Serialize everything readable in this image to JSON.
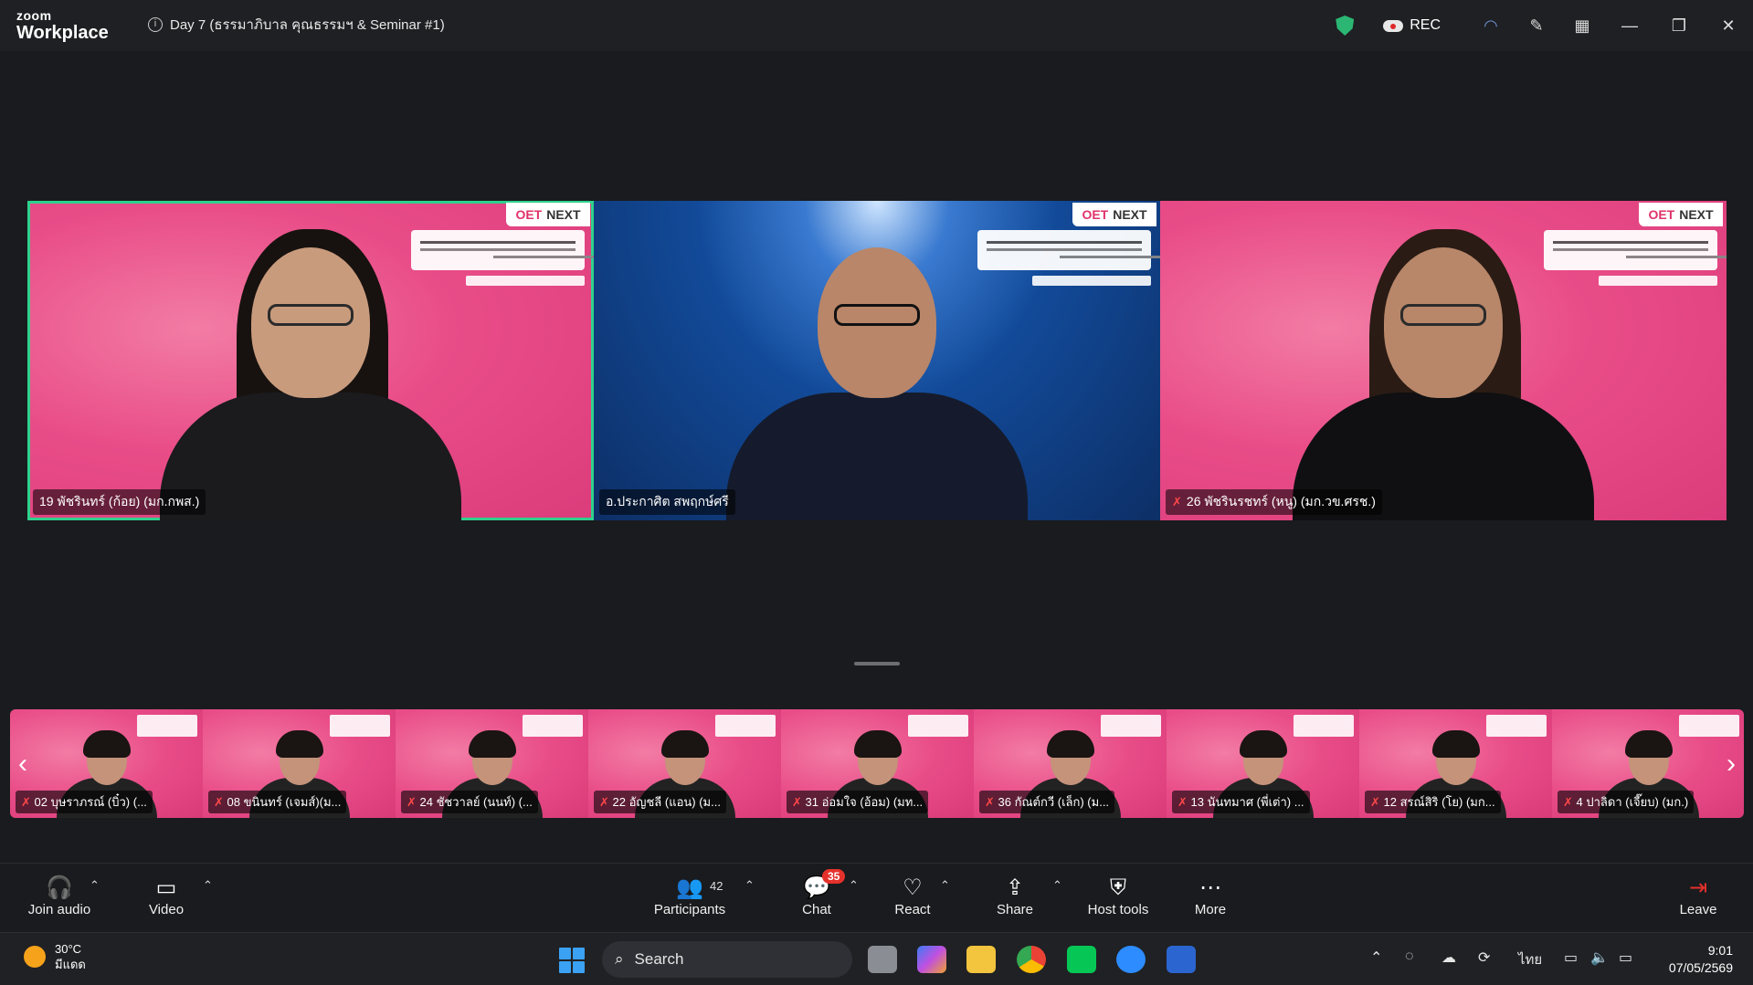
{
  "app": {
    "logo_small": "zoom",
    "logo_big": "Workplace"
  },
  "meeting": {
    "title": "Day 7 (ธรรมาภิบาล คุณธรรมฯ & Seminar #1)"
  },
  "titlebar": {
    "rec_label": "REC"
  },
  "slide_brand": {
    "left": "OET",
    "right": "NEXT"
  },
  "main_tiles": [
    {
      "name": "19 พัชรินทร์ (ก้อย) (มก.กพส.)",
      "muted": false,
      "active": true,
      "bg": "pink"
    },
    {
      "name": "อ.ประกาศิต สพฤกษ์ศรี",
      "muted": false,
      "active": false,
      "bg": "blue"
    },
    {
      "name": "26 พัชรินรชทร์ (หนู) (มก.วข.ศรช.)",
      "muted": true,
      "active": false,
      "bg": "pink"
    }
  ],
  "thumbnails": [
    {
      "name": "02 บุษราภรณ์ (บิ๋ว) (..."
    },
    {
      "name": "08 ขนินทร์ (เจมส์)(ม..."
    },
    {
      "name": "24 ชัชวาลย์ (นนท์) (..."
    },
    {
      "name": "22 อัญชลี (แอน) (ม..."
    },
    {
      "name": "31 อ่อมใจ (อ้อม) (มท..."
    },
    {
      "name": "36 กัณต์กวี (เล็ก) (ม..."
    },
    {
      "name": "13 นันทมาศ (พี่เต่า) ..."
    },
    {
      "name": "12 สรณ์สิริ (โย) (มก..."
    },
    {
      "name": "4 ปาลิดา (เจี๊ยบ) (มก.)"
    }
  ],
  "toolbar": {
    "join_audio": "Join audio",
    "video": "Video",
    "participants": "Participants",
    "participants_count": "42",
    "chat": "Chat",
    "chat_badge": "35",
    "react": "React",
    "share": "Share",
    "host_tools": "Host tools",
    "more": "More",
    "leave": "Leave"
  },
  "taskbar": {
    "weather_temp": "30°C",
    "weather_desc": "มีแดด",
    "search_label": "Search",
    "language": "ไทย",
    "time": "9:01",
    "date": "07/05/2569"
  },
  "colors": {
    "accent_green": "#2fd18c",
    "rec_red": "#e02828",
    "badge_red": "#e5312b"
  }
}
